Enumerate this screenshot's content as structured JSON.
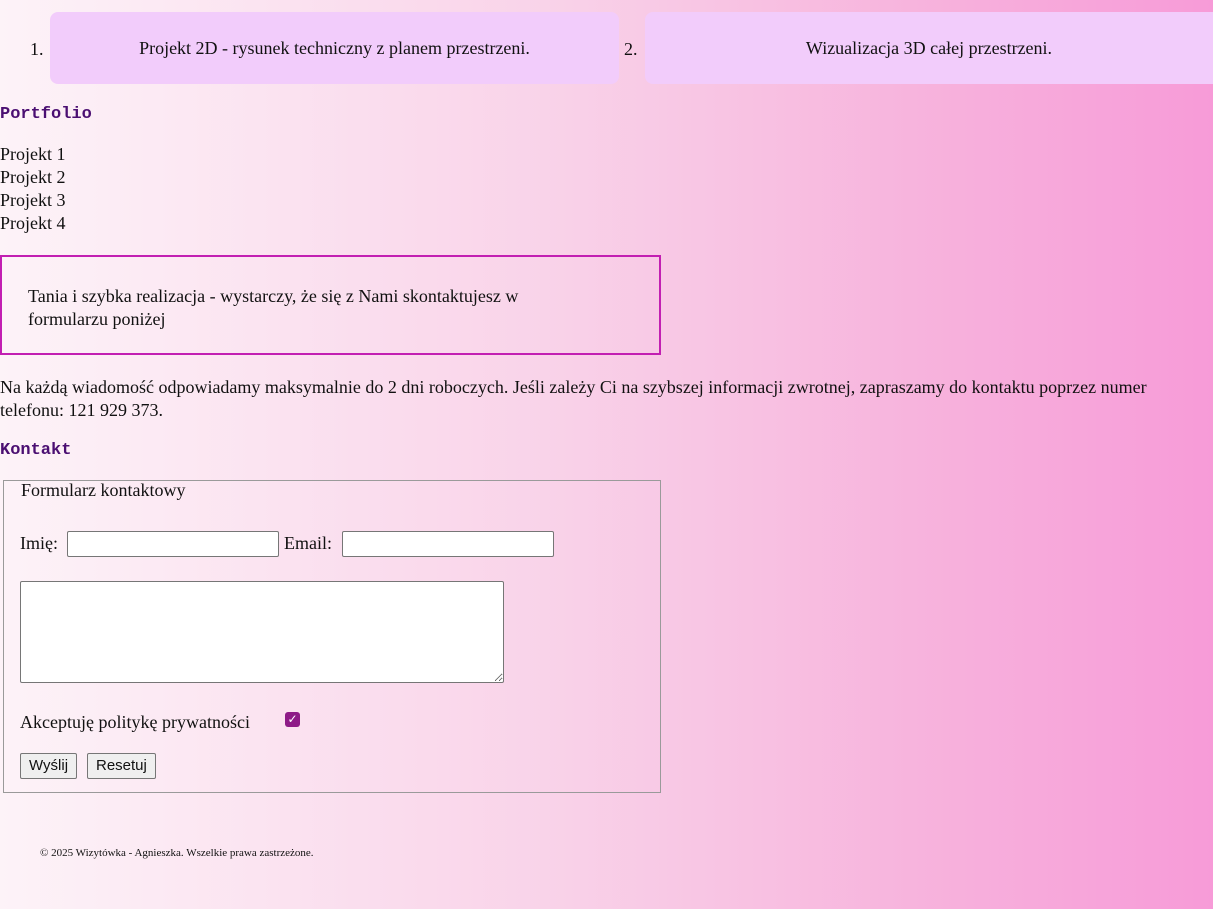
{
  "services": [
    {
      "number": "1.",
      "text": "Projekt 2D - rysunek techniczny z planem przestrzeni."
    },
    {
      "number": "2.",
      "text": "Wizualizacja 3D całej przestrzeni."
    }
  ],
  "portfolio": {
    "heading": "Portfolio",
    "items": [
      "Projekt 1",
      "Projekt 2",
      "Projekt 3",
      "Projekt 4"
    ]
  },
  "promo": {
    "text": "Tania i szybka realizacja - wystarczy, że się z Nami skontaktujesz w formularzu poniżej",
    "border_color": "#c21fb2"
  },
  "info": {
    "text": "Na każdą wiadomość odpowiadamy maksymalnie do 2 dni roboczych. Jeśli zależy Ci na szybszej informacji zwrotnej, zapraszamy do kontaktu poprzez numer telefonu: 121 929 373."
  },
  "contact": {
    "heading": "Kontakt",
    "form": {
      "legend": "Formularz kontaktowy",
      "name_label": "Imię:",
      "name_value": "",
      "email_label": "Email:",
      "email_value": "",
      "message_value": "",
      "consent_label": "Akceptuję politykę prywatności",
      "consent_checked": true,
      "submit_label": "Wyślij",
      "reset_label": "Resetuj"
    }
  },
  "footer": {
    "text": "© 2025 Wizytówka - Agnieszka. Wszelkie prawa zastrzeżone."
  },
  "colors": {
    "heading": "#4b0f72",
    "service_box": "#f2ccfb",
    "checkbox": "#8e1b87",
    "background_start": "#fdf3f8",
    "background_end": "#f79bd8"
  }
}
